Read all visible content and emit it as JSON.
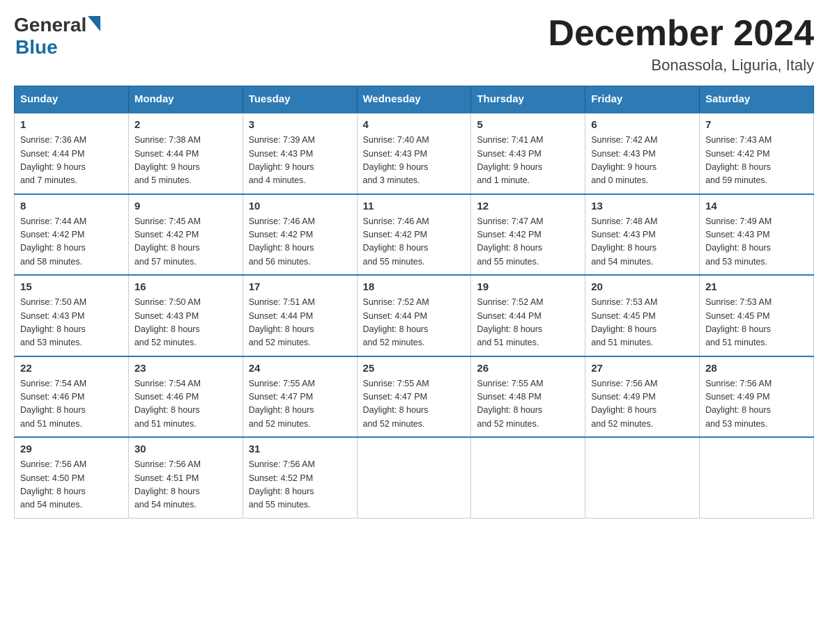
{
  "header": {
    "logo_general": "General",
    "logo_blue": "Blue",
    "month_title": "December 2024",
    "location": "Bonassola, Liguria, Italy"
  },
  "days_of_week": [
    "Sunday",
    "Monday",
    "Tuesday",
    "Wednesday",
    "Thursday",
    "Friday",
    "Saturday"
  ],
  "weeks": [
    [
      {
        "day": "1",
        "sunrise": "7:36 AM",
        "sunset": "4:44 PM",
        "daylight": "9 hours and 7 minutes."
      },
      {
        "day": "2",
        "sunrise": "7:38 AM",
        "sunset": "4:44 PM",
        "daylight": "9 hours and 5 minutes."
      },
      {
        "day": "3",
        "sunrise": "7:39 AM",
        "sunset": "4:43 PM",
        "daylight": "9 hours and 4 minutes."
      },
      {
        "day": "4",
        "sunrise": "7:40 AM",
        "sunset": "4:43 PM",
        "daylight": "9 hours and 3 minutes."
      },
      {
        "day": "5",
        "sunrise": "7:41 AM",
        "sunset": "4:43 PM",
        "daylight": "9 hours and 1 minute."
      },
      {
        "day": "6",
        "sunrise": "7:42 AM",
        "sunset": "4:43 PM",
        "daylight": "9 hours and 0 minutes."
      },
      {
        "day": "7",
        "sunrise": "7:43 AM",
        "sunset": "4:42 PM",
        "daylight": "8 hours and 59 minutes."
      }
    ],
    [
      {
        "day": "8",
        "sunrise": "7:44 AM",
        "sunset": "4:42 PM",
        "daylight": "8 hours and 58 minutes."
      },
      {
        "day": "9",
        "sunrise": "7:45 AM",
        "sunset": "4:42 PM",
        "daylight": "8 hours and 57 minutes."
      },
      {
        "day": "10",
        "sunrise": "7:46 AM",
        "sunset": "4:42 PM",
        "daylight": "8 hours and 56 minutes."
      },
      {
        "day": "11",
        "sunrise": "7:46 AM",
        "sunset": "4:42 PM",
        "daylight": "8 hours and 55 minutes."
      },
      {
        "day": "12",
        "sunrise": "7:47 AM",
        "sunset": "4:42 PM",
        "daylight": "8 hours and 55 minutes."
      },
      {
        "day": "13",
        "sunrise": "7:48 AM",
        "sunset": "4:43 PM",
        "daylight": "8 hours and 54 minutes."
      },
      {
        "day": "14",
        "sunrise": "7:49 AM",
        "sunset": "4:43 PM",
        "daylight": "8 hours and 53 minutes."
      }
    ],
    [
      {
        "day": "15",
        "sunrise": "7:50 AM",
        "sunset": "4:43 PM",
        "daylight": "8 hours and 53 minutes."
      },
      {
        "day": "16",
        "sunrise": "7:50 AM",
        "sunset": "4:43 PM",
        "daylight": "8 hours and 52 minutes."
      },
      {
        "day": "17",
        "sunrise": "7:51 AM",
        "sunset": "4:44 PM",
        "daylight": "8 hours and 52 minutes."
      },
      {
        "day": "18",
        "sunrise": "7:52 AM",
        "sunset": "4:44 PM",
        "daylight": "8 hours and 52 minutes."
      },
      {
        "day": "19",
        "sunrise": "7:52 AM",
        "sunset": "4:44 PM",
        "daylight": "8 hours and 51 minutes."
      },
      {
        "day": "20",
        "sunrise": "7:53 AM",
        "sunset": "4:45 PM",
        "daylight": "8 hours and 51 minutes."
      },
      {
        "day": "21",
        "sunrise": "7:53 AM",
        "sunset": "4:45 PM",
        "daylight": "8 hours and 51 minutes."
      }
    ],
    [
      {
        "day": "22",
        "sunrise": "7:54 AM",
        "sunset": "4:46 PM",
        "daylight": "8 hours and 51 minutes."
      },
      {
        "day": "23",
        "sunrise": "7:54 AM",
        "sunset": "4:46 PM",
        "daylight": "8 hours and 51 minutes."
      },
      {
        "day": "24",
        "sunrise": "7:55 AM",
        "sunset": "4:47 PM",
        "daylight": "8 hours and 52 minutes."
      },
      {
        "day": "25",
        "sunrise": "7:55 AM",
        "sunset": "4:47 PM",
        "daylight": "8 hours and 52 minutes."
      },
      {
        "day": "26",
        "sunrise": "7:55 AM",
        "sunset": "4:48 PM",
        "daylight": "8 hours and 52 minutes."
      },
      {
        "day": "27",
        "sunrise": "7:56 AM",
        "sunset": "4:49 PM",
        "daylight": "8 hours and 52 minutes."
      },
      {
        "day": "28",
        "sunrise": "7:56 AM",
        "sunset": "4:49 PM",
        "daylight": "8 hours and 53 minutes."
      }
    ],
    [
      {
        "day": "29",
        "sunrise": "7:56 AM",
        "sunset": "4:50 PM",
        "daylight": "8 hours and 54 minutes."
      },
      {
        "day": "30",
        "sunrise": "7:56 AM",
        "sunset": "4:51 PM",
        "daylight": "8 hours and 54 minutes."
      },
      {
        "day": "31",
        "sunrise": "7:56 AM",
        "sunset": "4:52 PM",
        "daylight": "8 hours and 55 minutes."
      },
      null,
      null,
      null,
      null
    ]
  ],
  "labels": {
    "sunrise": "Sunrise:",
    "sunset": "Sunset:",
    "daylight": "Daylight:"
  }
}
